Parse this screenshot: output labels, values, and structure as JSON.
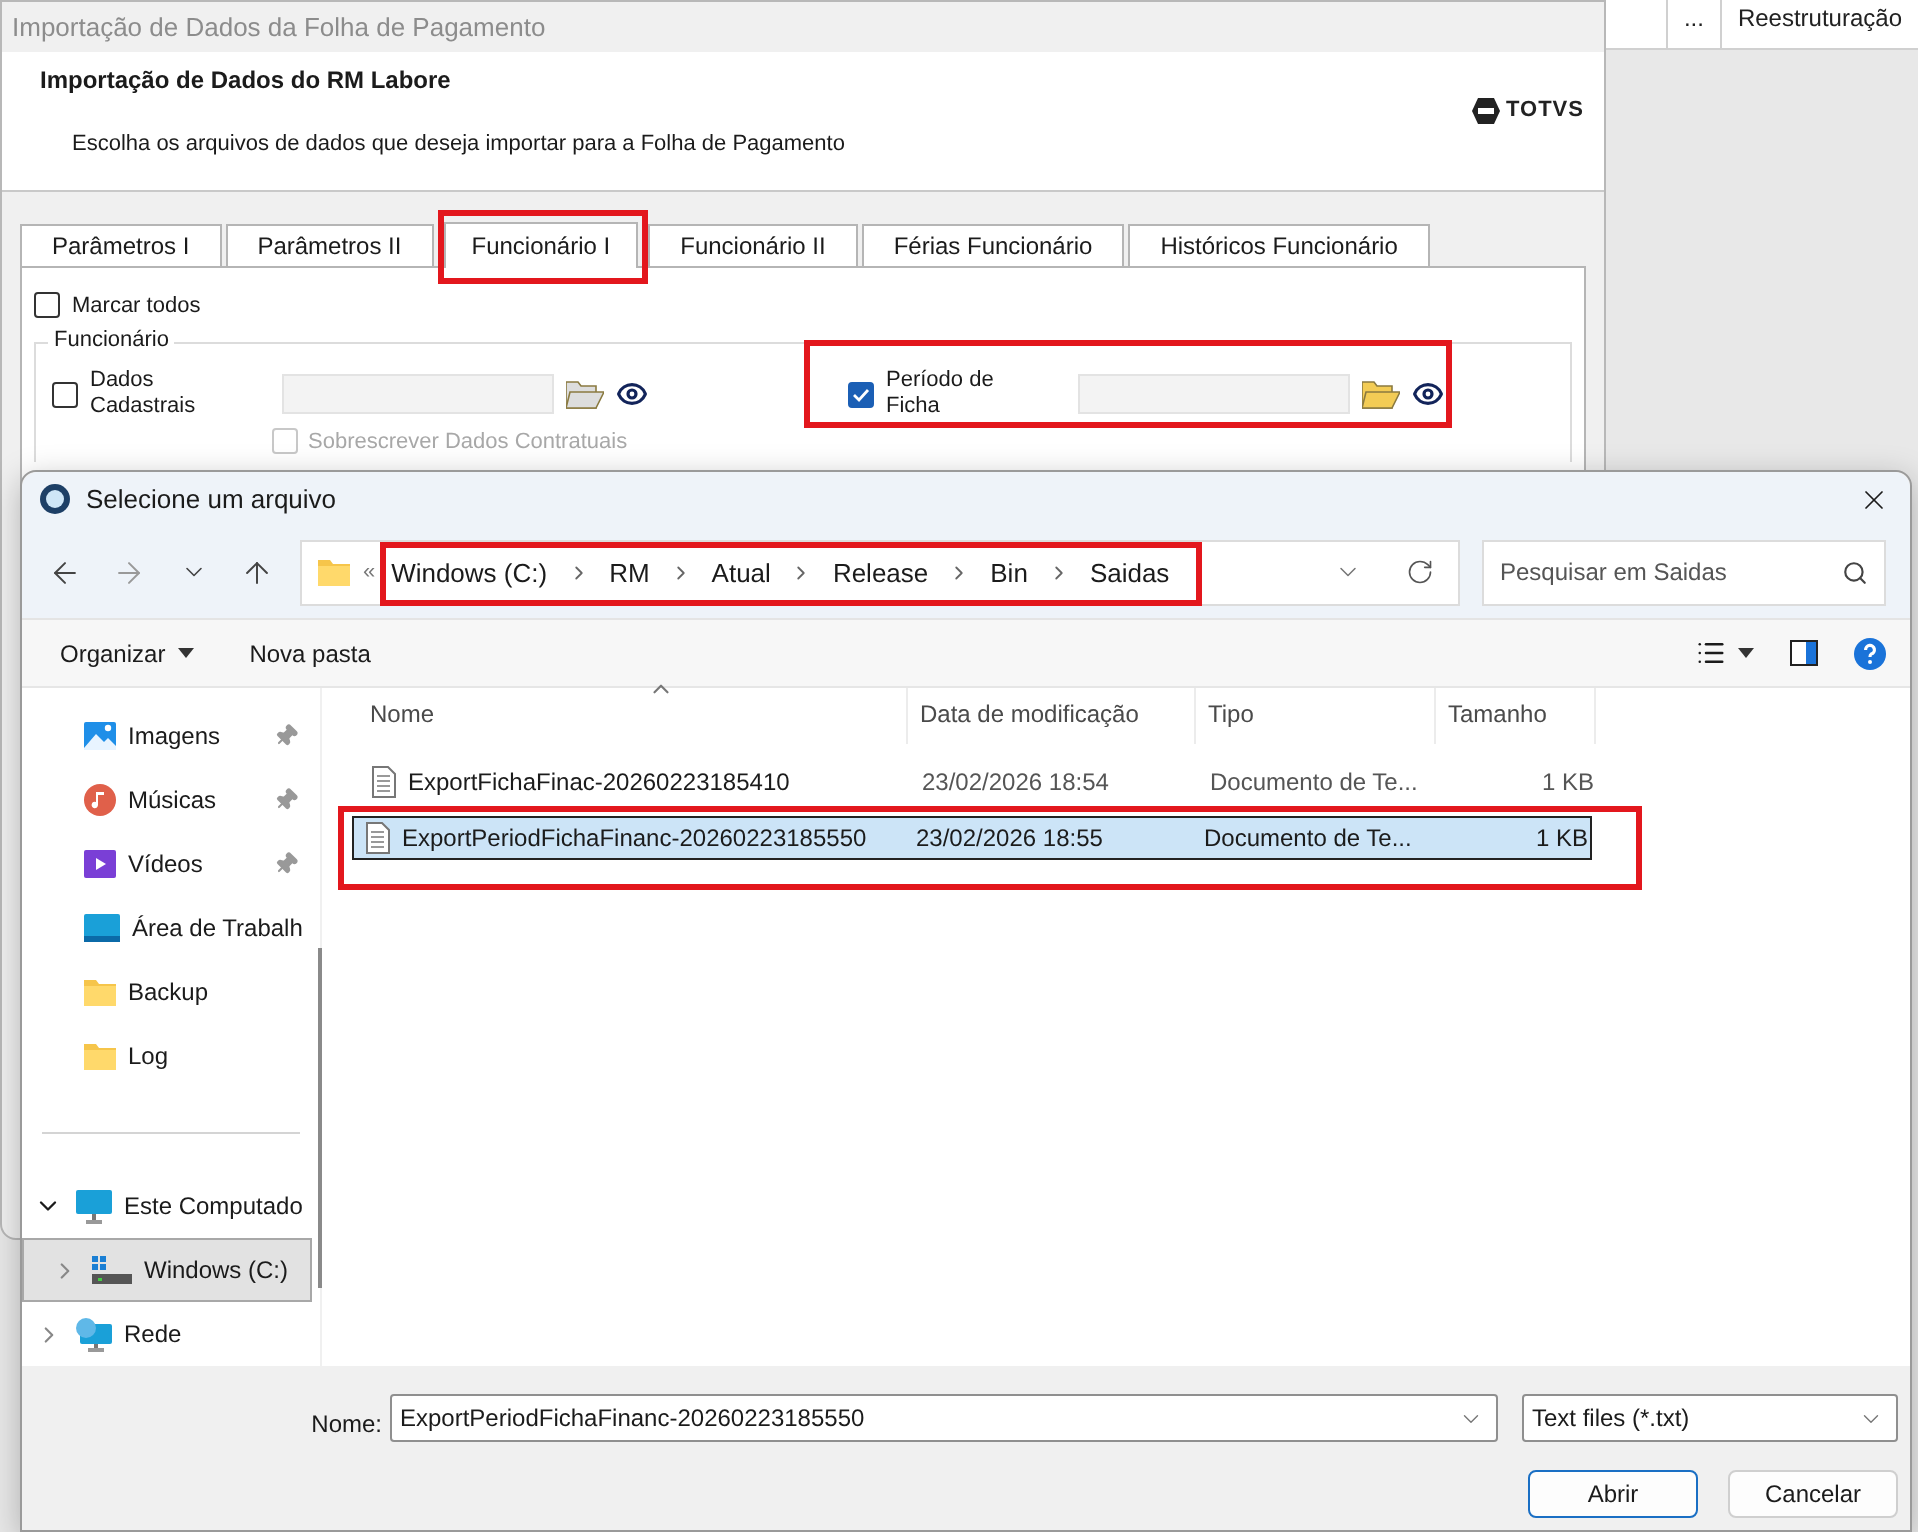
{
  "background_app": {
    "columns": [
      "...",
      "Reestruturação"
    ]
  },
  "background_window": {
    "title": "Importação de Dados da Folha de Pagamento",
    "heading": "Importação de Dados do RM Labore",
    "subtitle": "Escolha os arquivos de dados que deseja importar para a Folha de Pagamento",
    "logo": "TOTVS",
    "tabs": [
      {
        "label": "Parâmetros I",
        "selected": false,
        "highlighted": false
      },
      {
        "label": "Parâmetros II",
        "selected": false,
        "highlighted": false
      },
      {
        "label": "Funcionário I",
        "selected": true,
        "highlighted": true
      },
      {
        "label": "Funcionário II",
        "selected": false,
        "highlighted": false
      },
      {
        "label": "Férias Funcionário",
        "selected": false,
        "highlighted": false
      },
      {
        "label": "Históricos Funcionário",
        "selected": false,
        "highlighted": false
      }
    ],
    "select_all": {
      "label": "Marcar todos",
      "checked": false
    },
    "group": {
      "title": "Funcionário",
      "items": [
        {
          "label": "Dados Cadastrais",
          "checked": false,
          "highlighted": false,
          "sub_option": {
            "label": "Sobrescrever Dados  Contratuais",
            "checked": false,
            "disabled": true
          }
        },
        {
          "label": "Período de Ficha",
          "checked": true,
          "highlighted": true
        }
      ]
    }
  },
  "dialog": {
    "title": "Selecione um arquivo",
    "path_overflow": "«",
    "path": [
      "Windows (C:)",
      "RM",
      "Atual",
      "Release",
      "Bin",
      "Saidas"
    ],
    "path_highlighted": true,
    "search_placeholder": "Pesquisar em Saidas",
    "toolbar": [
      {
        "label": "Organizar",
        "kind": "menu"
      },
      {
        "label": "Nova pasta",
        "kind": "button"
      }
    ],
    "nav": [
      {
        "label": "Imagens",
        "kind": "images",
        "pinned": true,
        "selected": false
      },
      {
        "label": "Músicas",
        "kind": "music",
        "pinned": true,
        "selected": false
      },
      {
        "label": "Vídeos",
        "kind": "videos",
        "pinned": true,
        "selected": false
      },
      {
        "label": "Área de Trabalh",
        "kind": "desktop",
        "pinned": false,
        "selected": false
      },
      {
        "label": "Backup",
        "kind": "folder",
        "pinned": false,
        "selected": false
      },
      {
        "label": "Log",
        "kind": "folder",
        "pinned": false,
        "selected": false
      },
      {
        "label": "Este Computado",
        "kind": "computer",
        "pinned": false,
        "selected": false,
        "expanded": true,
        "children": [
          {
            "label": "Windows (C:)",
            "kind": "drive",
            "pinned": false,
            "selected": true,
            "expanded": false
          }
        ]
      },
      {
        "label": "Rede",
        "kind": "network",
        "pinned": false,
        "selected": false,
        "expanded": false
      }
    ],
    "columns": [
      {
        "label": "Nome",
        "sorted": true
      },
      {
        "label": "Data de modificação",
        "sorted": false
      },
      {
        "label": "Tipo",
        "sorted": false
      },
      {
        "label": "Tamanho",
        "sorted": false
      }
    ],
    "files": [
      {
        "name": "ExportFichaFinac-20260223185410",
        "modified": "23/02/2026 18:54",
        "type": "Documento de Te...",
        "size": "1 KB",
        "selected": false,
        "highlighted": false
      },
      {
        "name": "ExportPeriodFichaFinanc-20260223185550",
        "modified": "23/02/2026 18:55",
        "type": "Documento de Te...",
        "size": "1 KB",
        "selected": true,
        "highlighted": true
      }
    ],
    "file_name_label": "Nome:",
    "file_name": "ExportPeriodFichaFinanc-20260223185550",
    "filter": "Text files (*.txt)",
    "buttons": [
      {
        "label": "Abrir",
        "default": true
      },
      {
        "label": "Cancelar",
        "default": false
      }
    ]
  }
}
